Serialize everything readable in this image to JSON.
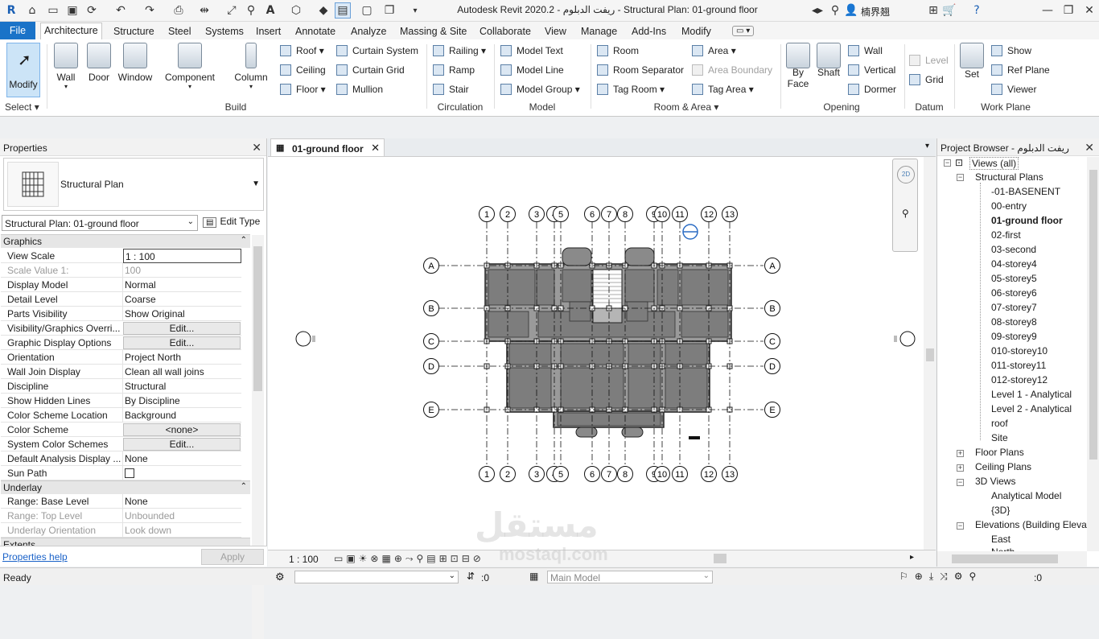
{
  "title_bar": {
    "app_title": "Autodesk Revit 2020.2 - ريفت الدبلوم - Structural Plan: 01-ground floor",
    "user": "楠界翘"
  },
  "menu": {
    "file": "File",
    "tabs": [
      "Architecture",
      "Structure",
      "Steel",
      "Systems",
      "Insert",
      "Annotate",
      "Analyze",
      "Massing & Site",
      "Collaborate",
      "View",
      "Manage",
      "Add-Ins",
      "Modify"
    ]
  },
  "ribbon": {
    "modify": "Modify",
    "select": "Select",
    "build": {
      "wall": "Wall",
      "door": "Door",
      "window": "Window",
      "component": "Component",
      "column": "Column",
      "roof": "Roof",
      "ceiling": "Ceiling",
      "floor": "Floor",
      "curtain_system": "Curtain System",
      "curtain_grid": "Curtain Grid",
      "mullion": "Mullion",
      "label": "Build"
    },
    "circulation": {
      "railing": "Railing",
      "ramp": "Ramp",
      "stair": "Stair",
      "label": "Circulation"
    },
    "model": {
      "model_text": "Model Text",
      "model_line": "Model Line",
      "model_group": "Model Group",
      "label": "Model"
    },
    "room_area": {
      "room": "Room",
      "room_separator": "Room Separator",
      "tag_room": "Tag Room",
      "area": "Area",
      "area_boundary": "Area Boundary",
      "tag_area": "Tag Area",
      "label": "Room & Area"
    },
    "opening": {
      "by_face": "By Face",
      "by_face2": "Face",
      "shaft": "Shaft",
      "wall": "Wall",
      "vertical": "Vertical",
      "dormer": "Dormer",
      "label": "Opening"
    },
    "datum": {
      "level": "Level",
      "grid": "Grid",
      "label": "Datum"
    },
    "work_plane": {
      "set": "Set",
      "show": "Show",
      "ref_plane": "Ref Plane",
      "viewer": "Viewer",
      "label": "Work Plane"
    }
  },
  "properties": {
    "title": "Properties",
    "type_name": "Structural Plan",
    "instance": "Structural Plan: 01-ground floor",
    "edit_type": "Edit Type",
    "section_graphics": "Graphics",
    "rows": [
      {
        "k": "View Scale",
        "v": "1 : 100"
      },
      {
        "k": "Scale Value    1:",
        "v": "100"
      },
      {
        "k": "Display Model",
        "v": "Normal"
      },
      {
        "k": "Detail Level",
        "v": "Coarse"
      },
      {
        "k": "Parts Visibility",
        "v": "Show Original"
      },
      {
        "k": "Visibility/Graphics Overri...",
        "v": "Edit..."
      },
      {
        "k": "Graphic Display Options",
        "v": "Edit..."
      },
      {
        "k": "Orientation",
        "v": "Project North"
      },
      {
        "k": "Wall Join Display",
        "v": "Clean all wall joins"
      },
      {
        "k": "Discipline",
        "v": "Structural"
      },
      {
        "k": "Show Hidden Lines",
        "v": "By Discipline"
      },
      {
        "k": "Color Scheme Location",
        "v": "Background"
      },
      {
        "k": "Color Scheme",
        "v": "<none>"
      },
      {
        "k": "System Color Schemes",
        "v": "Edit..."
      },
      {
        "k": "Default Analysis Display ...",
        "v": "None"
      },
      {
        "k": "Sun Path",
        "v": ""
      }
    ],
    "section_underlay": "Underlay",
    "underlay_rows": [
      {
        "k": "Range: Base Level",
        "v": "None"
      },
      {
        "k": "Range: Top Level",
        "v": "Unbounded"
      },
      {
        "k": "Underlay Orientation",
        "v": "Look down"
      }
    ],
    "section_extents": "Extents",
    "help": "Properties help",
    "apply": "Apply"
  },
  "view": {
    "tab": "01-ground floor",
    "scale": "1 : 100",
    "grids_vertical": [
      "1",
      "2",
      "3",
      "4",
      "5",
      "6",
      "7",
      "8",
      "9",
      "10",
      "11",
      "12",
      "13"
    ],
    "grids_horizontal": [
      "A",
      "B",
      "C",
      "D",
      "E"
    ]
  },
  "browser": {
    "title": "Project Browser - ريفت الدبلوم",
    "views_all": "Views (all)",
    "structural_plans": "Structural Plans",
    "plans": [
      "-01-BASENENT",
      "00-entry",
      "01-ground floor",
      "02-first",
      "03-second",
      "04-storey4",
      "05-storey5",
      "06-storey6",
      "07-storey7",
      "08-storey8",
      "09-storey9",
      "010-storey10",
      "011-storey11",
      "012-storey12",
      "Level 1 - Analytical",
      "Level 2 - Analytical",
      "roof",
      "Site"
    ],
    "floor_plans": "Floor Plans",
    "ceiling_plans": "Ceiling Plans",
    "views_3d": "3D Views",
    "views_3d_items": [
      "Analytical Model",
      "{3D}"
    ],
    "elevations": "Elevations (Building Elevat",
    "elev_items": [
      "East",
      "North"
    ]
  },
  "status": {
    "ready": "Ready",
    "zero1": ":0",
    "main_model": "Main Model",
    "zero2": ":0"
  },
  "watermark": {
    "arabic": "مستقل",
    "latin": "mostaql.com"
  }
}
